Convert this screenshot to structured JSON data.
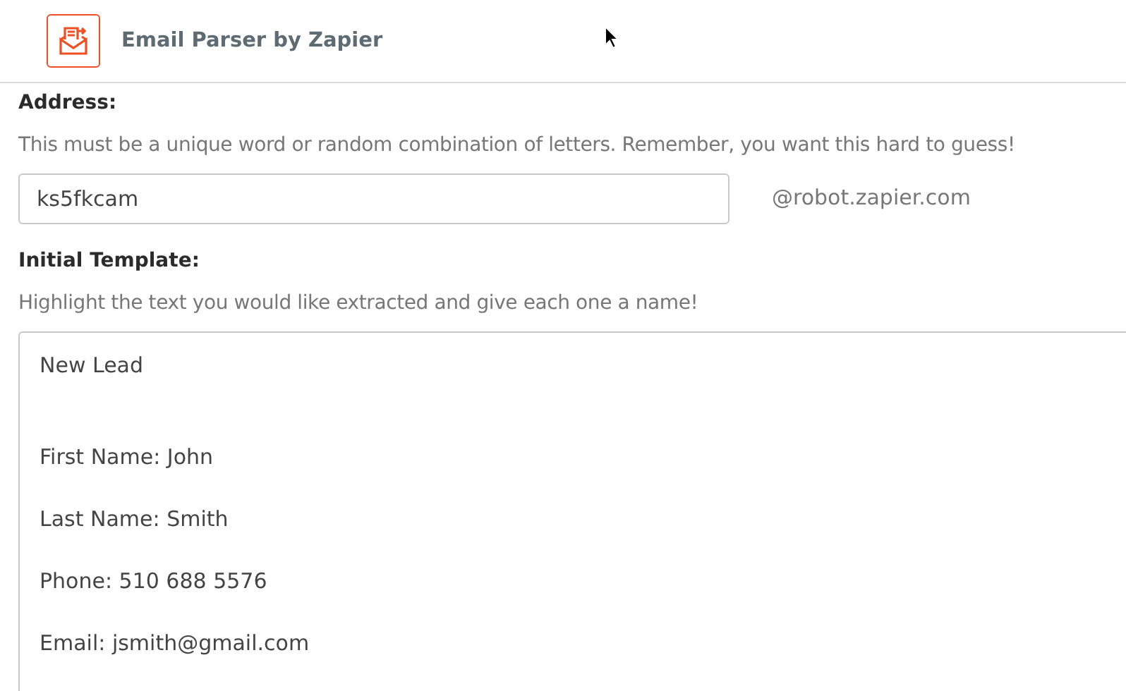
{
  "header": {
    "title": "Email Parser by Zapier"
  },
  "address": {
    "label": "Address:",
    "hint": "This must be a unique word or random combination of letters. Remember, you want this hard to guess!",
    "value": "ks5fkcam",
    "domain": "@robot.zapier.com"
  },
  "template": {
    "label": "Initial Template:",
    "hint": "Highlight the text you would like extracted and give each one a name!",
    "lines": [
      "New Lead",
      "First Name: John",
      "Last Name: Smith",
      "Phone: 510 688 5576",
      "Email: jsmith@gmail.com"
    ]
  }
}
